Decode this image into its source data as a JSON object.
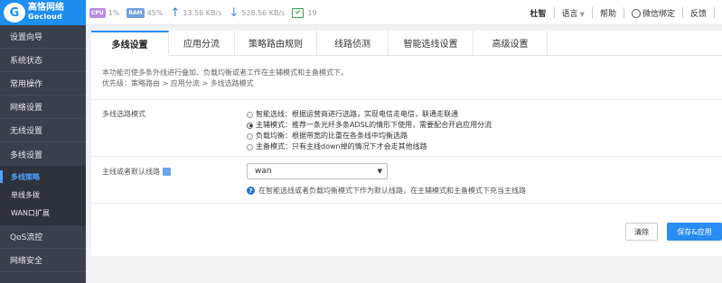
{
  "brand": {
    "cn": "高恪网络",
    "en": "Gocloud",
    "mark": "G"
  },
  "stats": {
    "cpu_chip": "CPU",
    "cpu": "1%",
    "ram_chip": "RAM",
    "ram": "45%",
    "up_icon": "arrow-up-icon",
    "upload": "13.56 KB/s",
    "down_icon": "arrow-down-icon",
    "download": "528.56 KB/s",
    "devices": "19"
  },
  "topright": {
    "user": "杜智",
    "language": "语言",
    "help": "帮助",
    "wechat": "微信绑定",
    "feedback": "反馈"
  },
  "sidebar": {
    "items": [
      "设置向导",
      "系统状态",
      "常用操作",
      "网络设置",
      "无线设置",
      "多线设置"
    ],
    "sub": [
      "多线策略",
      "单线多拨",
      "WAN口扩展"
    ],
    "after": [
      "QoS流控",
      "网络安全"
    ]
  },
  "tabs": [
    "多线设置",
    "应用分流",
    "策略路由规则",
    "线路侦测",
    "智能选线设置",
    "高级设置"
  ],
  "desc": {
    "line1": "本功能可使多条外线进行叠加、负载均衡或者工作在主辅模式和主备模式下。",
    "line2": "优先级：策略路由 > 应用分流 > 多线选路模式"
  },
  "mode": {
    "label": "多线选路模式",
    "options": [
      "智能选线：根据运营商进行选路，实现电信走电信，联通走联通",
      "主辅模式：推荐一条光纤多条ADSL的情形下使用，需要配合开启应用分流",
      "负载均衡：根据带宽的比重在各条线中均衡选路",
      "主备模式：只有主线down掉的情况下才会走其他线路"
    ],
    "selected_index": 1
  },
  "default_line": {
    "label": "主线或者默认线路",
    "value": "wan",
    "hint": "在智能选线或者负载均衡模式下作为默认线路，在主辅模式和主备模式下充当主线路"
  },
  "buttons": {
    "clear": "清除",
    "save": "保存&应用"
  },
  "colors": {
    "accent": "#2a8cf0",
    "sidebar_bg": "#3a3f4b",
    "logo_bg": "#1e8ef0"
  }
}
